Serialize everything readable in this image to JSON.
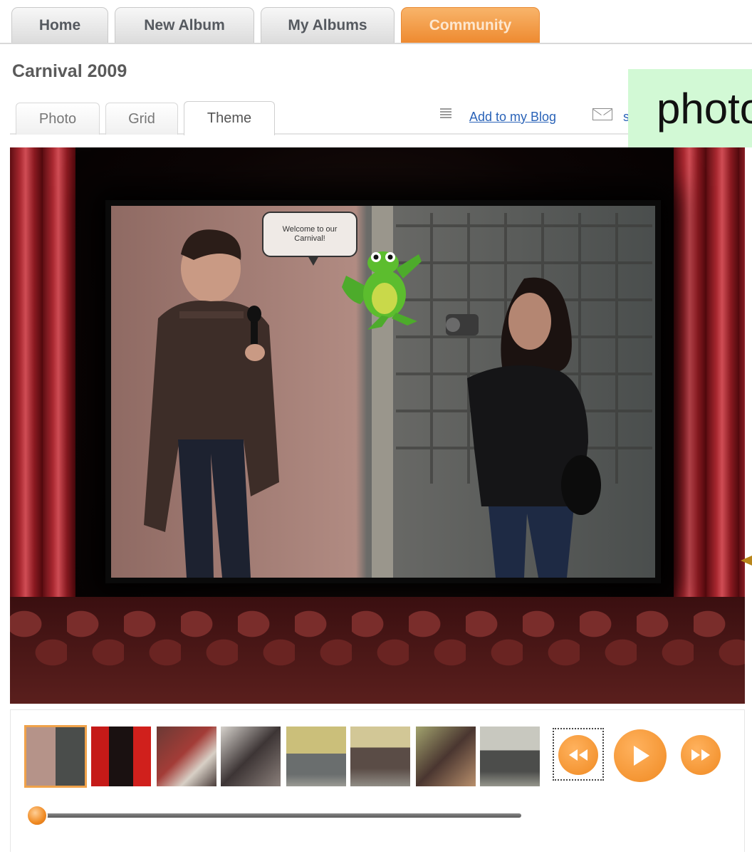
{
  "nav_tabs": [
    {
      "label": "Home"
    },
    {
      "label": "New Album"
    },
    {
      "label": "My Albums"
    },
    {
      "label": "Community"
    }
  ],
  "album": {
    "title": "Carnival 2009"
  },
  "view_tabs": [
    {
      "label": "Photo"
    },
    {
      "label": "Grid"
    },
    {
      "label": "Theme"
    }
  ],
  "actions": {
    "add_to_blog": "Add to my Blog",
    "share_partial": "s"
  },
  "overlay": {
    "text": "photo"
  },
  "photo": {
    "speech_bubble": "Welcome to our Carnival!"
  },
  "colors": {
    "accent": "#f08a22",
    "link": "#2a63b8",
    "overlay_bg": "#d2f9d5"
  },
  "player": {
    "thumbnail_count": 8,
    "active_thumbnail": 1,
    "progress": 0.02,
    "icons": [
      "rewind-icon",
      "play-icon",
      "fast-forward-icon"
    ]
  }
}
